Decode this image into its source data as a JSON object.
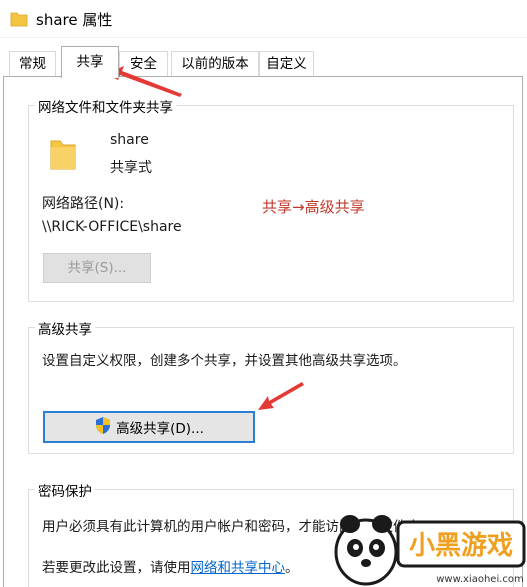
{
  "window": {
    "title": "share 属性"
  },
  "tabs": [
    {
      "label": "常规",
      "active": false
    },
    {
      "label": "共享",
      "active": true
    },
    {
      "label": "安全",
      "active": false
    },
    {
      "label": "以前的版本",
      "active": false
    },
    {
      "label": "自定义",
      "active": false
    }
  ],
  "network_sharing": {
    "group_title": "网络文件和文件夹共享",
    "share_name": "share",
    "share_type": "共享式",
    "path_label": "网络路径(N):",
    "path_value": "\\\\RICK-OFFICE\\share",
    "share_button": "共享(S)..."
  },
  "annotation": "共享→高级共享",
  "advanced_sharing": {
    "group_title": "高级共享",
    "description": "设置自定义权限，创建多个共享，并设置其他高级共享选项。",
    "button": "高级共享(D)..."
  },
  "password_protection": {
    "group_title": "密码保护",
    "description": "用户必须具有此计算机的用户帐户和密码，才能访问共享文件夹。",
    "link_prefix": "若要更改此设置，请使用",
    "link_text": "网络和共享中心",
    "link_suffix": "。"
  },
  "watermark": {
    "brand": "小黑游戏",
    "url": "www.xiaohei.com"
  },
  "colors": {
    "annotation": "#c0392b",
    "arrow": "#e53935",
    "focus_border": "#2a7fd4",
    "link": "#0066cc",
    "folder": "#f5c542"
  },
  "icons": [
    "folder-icon",
    "shield-icon",
    "arrow-icon"
  ]
}
